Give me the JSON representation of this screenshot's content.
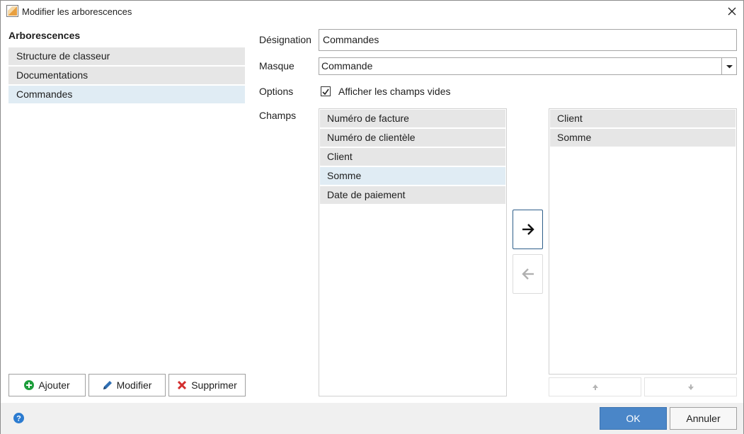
{
  "window": {
    "title": "Modifier les arborescences",
    "icon": "app-icon",
    "close_icon": "close-icon"
  },
  "left": {
    "title": "Arborescences",
    "items": [
      {
        "label": "Structure de classeur",
        "selected": false
      },
      {
        "label": "Documentations",
        "selected": false
      },
      {
        "label": "Commandes",
        "selected": true
      }
    ],
    "buttons": {
      "add": "Ajouter",
      "edit": "Modifier",
      "delete": "Supprimer"
    }
  },
  "form": {
    "designation_label": "Désignation",
    "designation_value": "Commandes",
    "mask_label": "Masque",
    "mask_value": "Commande",
    "options_label": "Options",
    "show_empty_label": "Afficher les champs vides",
    "show_empty_checked": true,
    "fields_label": "Champs",
    "available_fields": [
      {
        "label": "Numéro de facture",
        "selected": false
      },
      {
        "label": "Numéro de clientèle",
        "selected": false
      },
      {
        "label": "Client",
        "selected": false
      },
      {
        "label": "Somme",
        "selected": true
      },
      {
        "label": "Date de paiement",
        "selected": false
      }
    ],
    "selected_fields": [
      {
        "label": "Client"
      },
      {
        "label": "Somme"
      }
    ]
  },
  "footer": {
    "ok": "OK",
    "cancel": "Annuler",
    "help_icon": "help-icon"
  },
  "colors": {
    "accent": "#4a86c8",
    "selection": "#e0ecf4",
    "item_bg": "#e6e6e6",
    "add_icon": "#1e9e3c",
    "delete_icon": "#d32f2f",
    "edit_icon": "#2f6fb3"
  }
}
